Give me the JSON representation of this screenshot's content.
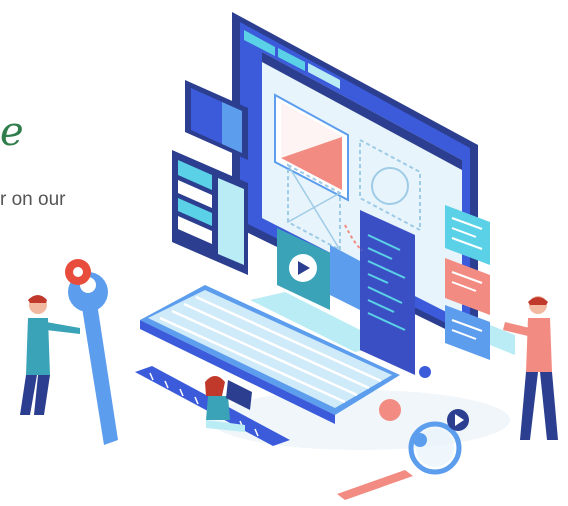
{
  "text": {
    "script_fragment": "e",
    "line_fragment": "r on our"
  },
  "colors": {
    "blue_dark": "#2c3e8f",
    "blue": "#3b5bdb",
    "blue_light": "#5c9ded",
    "cyan": "#5ad1e6",
    "cyan_light": "#b9ecf5",
    "salmon": "#f28b82",
    "red": "#e74c3c",
    "screen_bg": "#e8f4fb",
    "white": "#ffffff",
    "green_text": "#2f7d4a",
    "gray_text": "#555555"
  }
}
